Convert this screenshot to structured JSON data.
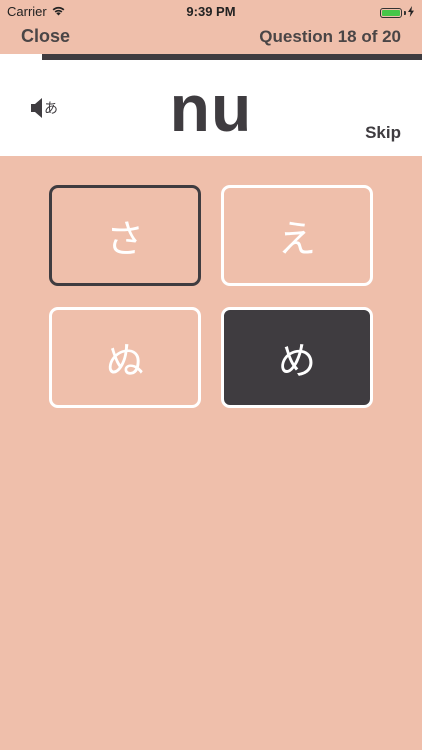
{
  "status_bar": {
    "carrier": "Carrier",
    "time": "9:39 PM",
    "icons": [
      "wifi-icon",
      "battery-icon",
      "charging-bolt-icon"
    ],
    "battery_color": "#46c749"
  },
  "nav": {
    "close_label": "Close",
    "question_counter": "Question 18 of 20"
  },
  "progress": {
    "fraction": 0.9
  },
  "prompt": {
    "audio_icon": "speaker-icon",
    "audio_kana": "あ",
    "romaji": "nu",
    "skip_label": "Skip"
  },
  "choices": [
    {
      "kana": "さ",
      "state": "highlighted"
    },
    {
      "kana": "え",
      "state": "normal"
    },
    {
      "kana": "ぬ",
      "state": "normal"
    },
    {
      "kana": "め",
      "state": "filled"
    }
  ],
  "colors": {
    "background": "#efbfab",
    "dark": "#3f3c40",
    "white": "#ffffff"
  }
}
